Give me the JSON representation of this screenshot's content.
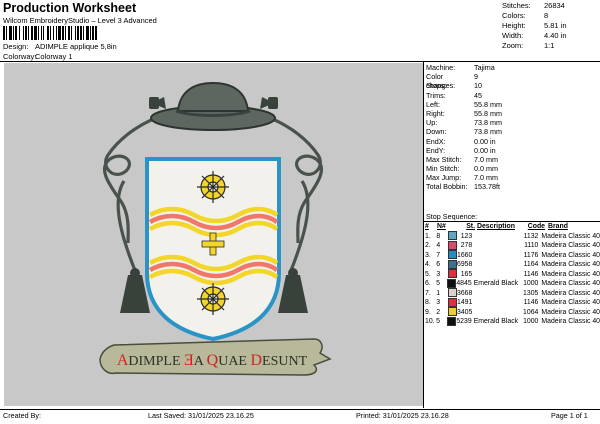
{
  "header": {
    "title": "Production Worksheet",
    "subtitle": "Wilcom EmbroideryStudio – Level 3 Advanced",
    "barcode_icon": "barcode-icon"
  },
  "stats": [
    {
      "label": "Stitches:",
      "value": "26834"
    },
    {
      "label": "Colors:",
      "value": "8"
    },
    {
      "label": "Height:",
      "value": "5.81 in"
    },
    {
      "label": "Width:",
      "value": "4.40 in"
    },
    {
      "label": "Zoom:",
      "value": "1:1"
    }
  ],
  "design": {
    "label": "Design:",
    "value": "ADIMPLE applique 5,8in"
  },
  "colorway": {
    "label": "Colorway:",
    "value": "Colorway 1"
  },
  "machine": [
    {
      "label": "Machine:",
      "value": "Tajima"
    },
    {
      "label": "Color changes:",
      "value": "9"
    },
    {
      "label": "Stops:",
      "value": "10"
    },
    {
      "label": "Trims:",
      "value": "45"
    },
    {
      "label": "Left:",
      "value": "55.8 mm"
    },
    {
      "label": "Right:",
      "value": "55.8 mm"
    },
    {
      "label": "Up:",
      "value": "73.8 mm"
    },
    {
      "label": "Down:",
      "value": "73.8 mm"
    },
    {
      "label": "EndX:",
      "value": "0.00 in"
    },
    {
      "label": "EndY:",
      "value": "0.00 in"
    },
    {
      "label": "Max Stitch:",
      "value": "7.0 mm"
    },
    {
      "label": "Min Stitch:",
      "value": "0.0 mm"
    },
    {
      "label": "Max Jump:",
      "value": "7.0 mm"
    },
    {
      "label": "Total Bobbin:",
      "value": "153.78ft"
    }
  ],
  "stop_sequence": {
    "title": "Stop Sequence:",
    "headers": {
      "num": "#",
      "n": "N#",
      "st": "St.",
      "desc": "Description",
      "code": "Code",
      "brand": "Brand"
    },
    "rows": [
      {
        "num": "1.",
        "n": "8",
        "color": "#5fa6c4",
        "st": "123",
        "desc": "",
        "code": "1132",
        "brand": "Madeira Classic 40"
      },
      {
        "num": "2.",
        "n": "4",
        "color": "#d84a6e",
        "st": "278",
        "desc": "",
        "code": "1110",
        "brand": "Madeira Classic 40"
      },
      {
        "num": "3.",
        "n": "7",
        "color": "#2a8bbf",
        "st": "1660",
        "desc": "",
        "code": "1176",
        "brand": "Madeira Classic 40"
      },
      {
        "num": "4.",
        "n": "6",
        "color": "#3d6f8f",
        "st": "6958",
        "desc": "",
        "code": "1164",
        "brand": "Madeira Classic 40"
      },
      {
        "num": "5.",
        "n": "3",
        "color": "#e0303e",
        "st": "165",
        "desc": "",
        "code": "1146",
        "brand": "Madeira Classic 40"
      },
      {
        "num": "6.",
        "n": "5",
        "color": "#111111",
        "st": "4845",
        "desc": "Emerald Black",
        "code": "1000",
        "brand": "Madeira Classic 40"
      },
      {
        "num": "7.",
        "n": "1",
        "color": "#d8d4cc",
        "st": "3668",
        "desc": "",
        "code": "1305",
        "brand": "Madeira Classic 40"
      },
      {
        "num": "8.",
        "n": "3",
        "color": "#e0303e",
        "st": "1491",
        "desc": "",
        "code": "1146",
        "brand": "Madeira Classic 40"
      },
      {
        "num": "9.",
        "n": "2",
        "color": "#f0d020",
        "st": "3405",
        "desc": "",
        "code": "1064",
        "brand": "Madeira Classic 40"
      },
      {
        "num": "10.",
        "n": "5",
        "color": "#111111",
        "st": "5239",
        "desc": "Emerald Black",
        "code": "1000",
        "brand": "Madeira Classic 40"
      }
    ]
  },
  "design_preview": {
    "motto": "ADIMPLE EA QUAE DESUNT",
    "motto_text": "ADIMPLE ƎA QUAE DESUNT",
    "motto_caps_color": "#d42020",
    "background": "#c8c8c8"
  },
  "footer": {
    "created": "Created By:",
    "last_saved": "Last Saved: 31/01/2025 23.16.25",
    "printed": "Printed: 31/01/2025 23.16.28",
    "page": "Page 1 of 1"
  }
}
